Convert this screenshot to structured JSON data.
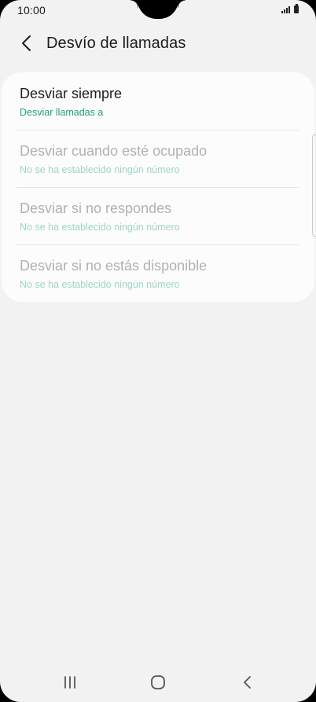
{
  "status_bar": {
    "time": "10:00"
  },
  "app_bar": {
    "title": "Desvío de llamadas",
    "back_icon": "chevron-left-icon"
  },
  "options": [
    {
      "title": "Desviar siempre",
      "subtitle": "Desviar llamadas a",
      "enabled": true
    },
    {
      "title": "Desviar cuando esté ocupado",
      "subtitle": "No se ha establecido ningún número",
      "enabled": false
    },
    {
      "title": "Desviar si no respondes",
      "subtitle": "No se ha establecido ningún número",
      "enabled": false
    },
    {
      "title": "Desviar si no estás disponible",
      "subtitle": "No se ha establecido ningún número",
      "enabled": false
    }
  ],
  "navigation_bar": {
    "recent_icon": "recent-apps-icon",
    "home_icon": "home-icon",
    "back_icon": "back-icon"
  },
  "colors": {
    "background": "#f2f2f2",
    "card": "#fcfcfc",
    "accent_green": "#20a26a",
    "disabled_green": "#9fd6bd",
    "disabled_text": "#b1b1b1"
  }
}
